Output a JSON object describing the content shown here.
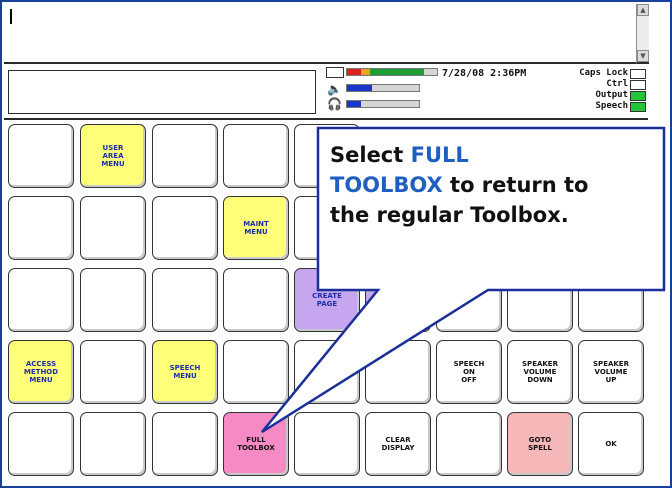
{
  "message": {
    "text": ""
  },
  "status": {
    "datetime": "7/28/08 2:36PM",
    "locks": [
      {
        "label": "Caps Lock",
        "on": false,
        "color": "#ffffff"
      },
      {
        "label": "Ctrl",
        "on": false,
        "color": "#ffffff"
      },
      {
        "label": "Output",
        "on": true,
        "color": "#22c43a"
      },
      {
        "label": "Speech",
        "on": true,
        "color": "#22c43a"
      }
    ],
    "meters": {
      "battery_level": 0.85,
      "volume_level": 0.35,
      "headphone_level": 0.2
    }
  },
  "keys": [
    {
      "row": 0,
      "col": 0,
      "label": "",
      "color": "white"
    },
    {
      "row": 0,
      "col": 1,
      "label": "USER\nAREA\nMENU",
      "color": "yellow"
    },
    {
      "row": 0,
      "col": 2,
      "label": "",
      "color": "white"
    },
    {
      "row": 0,
      "col": 3,
      "label": "",
      "color": "white"
    },
    {
      "row": 0,
      "col": 4,
      "label": "",
      "color": "white"
    },
    {
      "row": 1,
      "col": 0,
      "label": "",
      "color": "white"
    },
    {
      "row": 1,
      "col": 1,
      "label": "",
      "color": "white"
    },
    {
      "row": 1,
      "col": 2,
      "label": "",
      "color": "white"
    },
    {
      "row": 1,
      "col": 3,
      "label": "MAINT\nMENU",
      "color": "yellow"
    },
    {
      "row": 1,
      "col": 4,
      "label": "",
      "color": "white"
    },
    {
      "row": 2,
      "col": 0,
      "label": "",
      "color": "white"
    },
    {
      "row": 2,
      "col": 1,
      "label": "",
      "color": "white"
    },
    {
      "row": 2,
      "col": 2,
      "label": "",
      "color": "white"
    },
    {
      "row": 2,
      "col": 3,
      "label": "",
      "color": "white"
    },
    {
      "row": 2,
      "col": 4,
      "label": "CREATE\nPAGE",
      "color": "purple"
    },
    {
      "row": 2,
      "col": 5,
      "label": "",
      "color": "purple"
    },
    {
      "row": 2,
      "col": 6,
      "label": "",
      "color": "white"
    },
    {
      "row": 2,
      "col": 7,
      "label": "",
      "color": "white"
    },
    {
      "row": 2,
      "col": 8,
      "label": "",
      "color": "white"
    },
    {
      "row": 3,
      "col": 0,
      "label": "ACCESS\nMETHOD\nMENU",
      "color": "yellow"
    },
    {
      "row": 3,
      "col": 1,
      "label": "",
      "color": "white"
    },
    {
      "row": 3,
      "col": 2,
      "label": "SPEECH\nMENU",
      "color": "yellow"
    },
    {
      "row": 3,
      "col": 3,
      "label": "",
      "color": "white"
    },
    {
      "row": 3,
      "col": 4,
      "label": "",
      "color": "white"
    },
    {
      "row": 3,
      "col": 5,
      "label": "",
      "color": "white"
    },
    {
      "row": 3,
      "col": 6,
      "label": "SPEECH\nON\nOFF",
      "color": "white"
    },
    {
      "row": 3,
      "col": 7,
      "label": "SPEAKER\nVOLUME\nDOWN",
      "color": "white"
    },
    {
      "row": 3,
      "col": 8,
      "label": "SPEAKER\nVOLUME\nUP",
      "color": "white"
    },
    {
      "row": 4,
      "col": 0,
      "label": "",
      "color": "white"
    },
    {
      "row": 4,
      "col": 1,
      "label": "",
      "color": "white"
    },
    {
      "row": 4,
      "col": 2,
      "label": "",
      "color": "white"
    },
    {
      "row": 4,
      "col": 3,
      "label": "FULL\nTOOLBOX",
      "color": "pink"
    },
    {
      "row": 4,
      "col": 4,
      "label": "",
      "color": "white"
    },
    {
      "row": 4,
      "col": 5,
      "label": "CLEAR\nDISPLAY",
      "color": "white"
    },
    {
      "row": 4,
      "col": 6,
      "label": "",
      "color": "white"
    },
    {
      "row": 4,
      "col": 7,
      "label": "GOTO\nSPELL",
      "color": "salmon"
    },
    {
      "row": 4,
      "col": 8,
      "label": "OK",
      "color": "white"
    }
  ],
  "callout": {
    "line1_prefix": "Select ",
    "line1_highlight": "FULL",
    "line2_highlight": "TOOLBOX",
    "line2_suffix": " to return to",
    "line3": "the regular Toolbox.",
    "highlight_color": "#1f5fc2"
  }
}
